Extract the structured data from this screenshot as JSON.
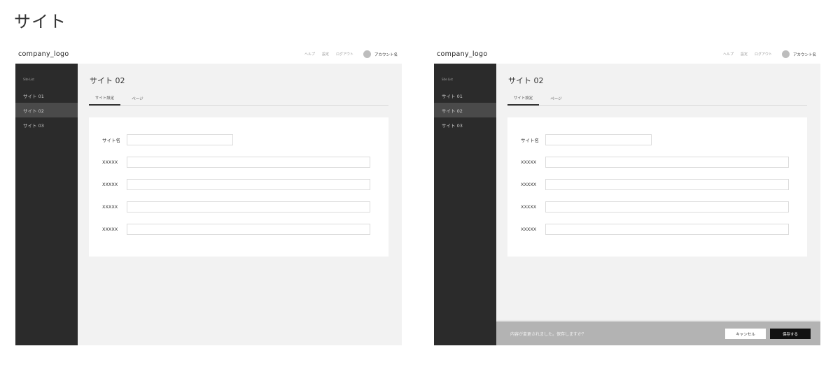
{
  "page_title": "サイト",
  "screens": [
    {
      "header": {
        "logo": "company_logo",
        "nav": [
          "ヘルプ",
          "設定",
          "ログアウト"
        ],
        "account_name": "アカウント名"
      },
      "sidebar": {
        "heading": "Site List",
        "items": [
          {
            "label": "サイト 01",
            "active": false
          },
          {
            "label": "サイト 02",
            "active": true
          },
          {
            "label": "サイト 03",
            "active": false
          }
        ]
      },
      "main": {
        "title": "サイト 02",
        "tabs": [
          {
            "label": "サイト設定",
            "active": true
          },
          {
            "label": "ページ",
            "active": false
          }
        ],
        "form": [
          {
            "label": "サイト名",
            "value": ""
          },
          {
            "label": "XXXXX",
            "value": ""
          },
          {
            "label": "XXXXX",
            "value": ""
          },
          {
            "label": "XXXXX",
            "value": ""
          },
          {
            "label": "XXXXX",
            "value": ""
          }
        ]
      }
    },
    {
      "header": {
        "logo": "company_logo",
        "nav": [
          "ヘルプ",
          "設定",
          "ログアウト"
        ],
        "account_name": "アカウント名"
      },
      "sidebar": {
        "heading": "Site List",
        "items": [
          {
            "label": "サイト 01",
            "active": false
          },
          {
            "label": "サイト 02",
            "active": true
          },
          {
            "label": "サイト 03",
            "active": false
          }
        ]
      },
      "main": {
        "title": "サイト 02",
        "tabs": [
          {
            "label": "サイト設定",
            "active": true
          },
          {
            "label": "ページ",
            "active": false
          }
        ],
        "form": [
          {
            "label": "サイト名",
            "value": ""
          },
          {
            "label": "XXXXX",
            "value": ""
          },
          {
            "label": "XXXXX",
            "value": ""
          },
          {
            "label": "XXXXX",
            "value": ""
          },
          {
            "label": "XXXXX",
            "value": ""
          }
        ],
        "save_bar": {
          "message": "内容が変更されました。保存しますか？",
          "cancel_label": "キャンセル",
          "save_label": "保存する"
        }
      }
    }
  ]
}
